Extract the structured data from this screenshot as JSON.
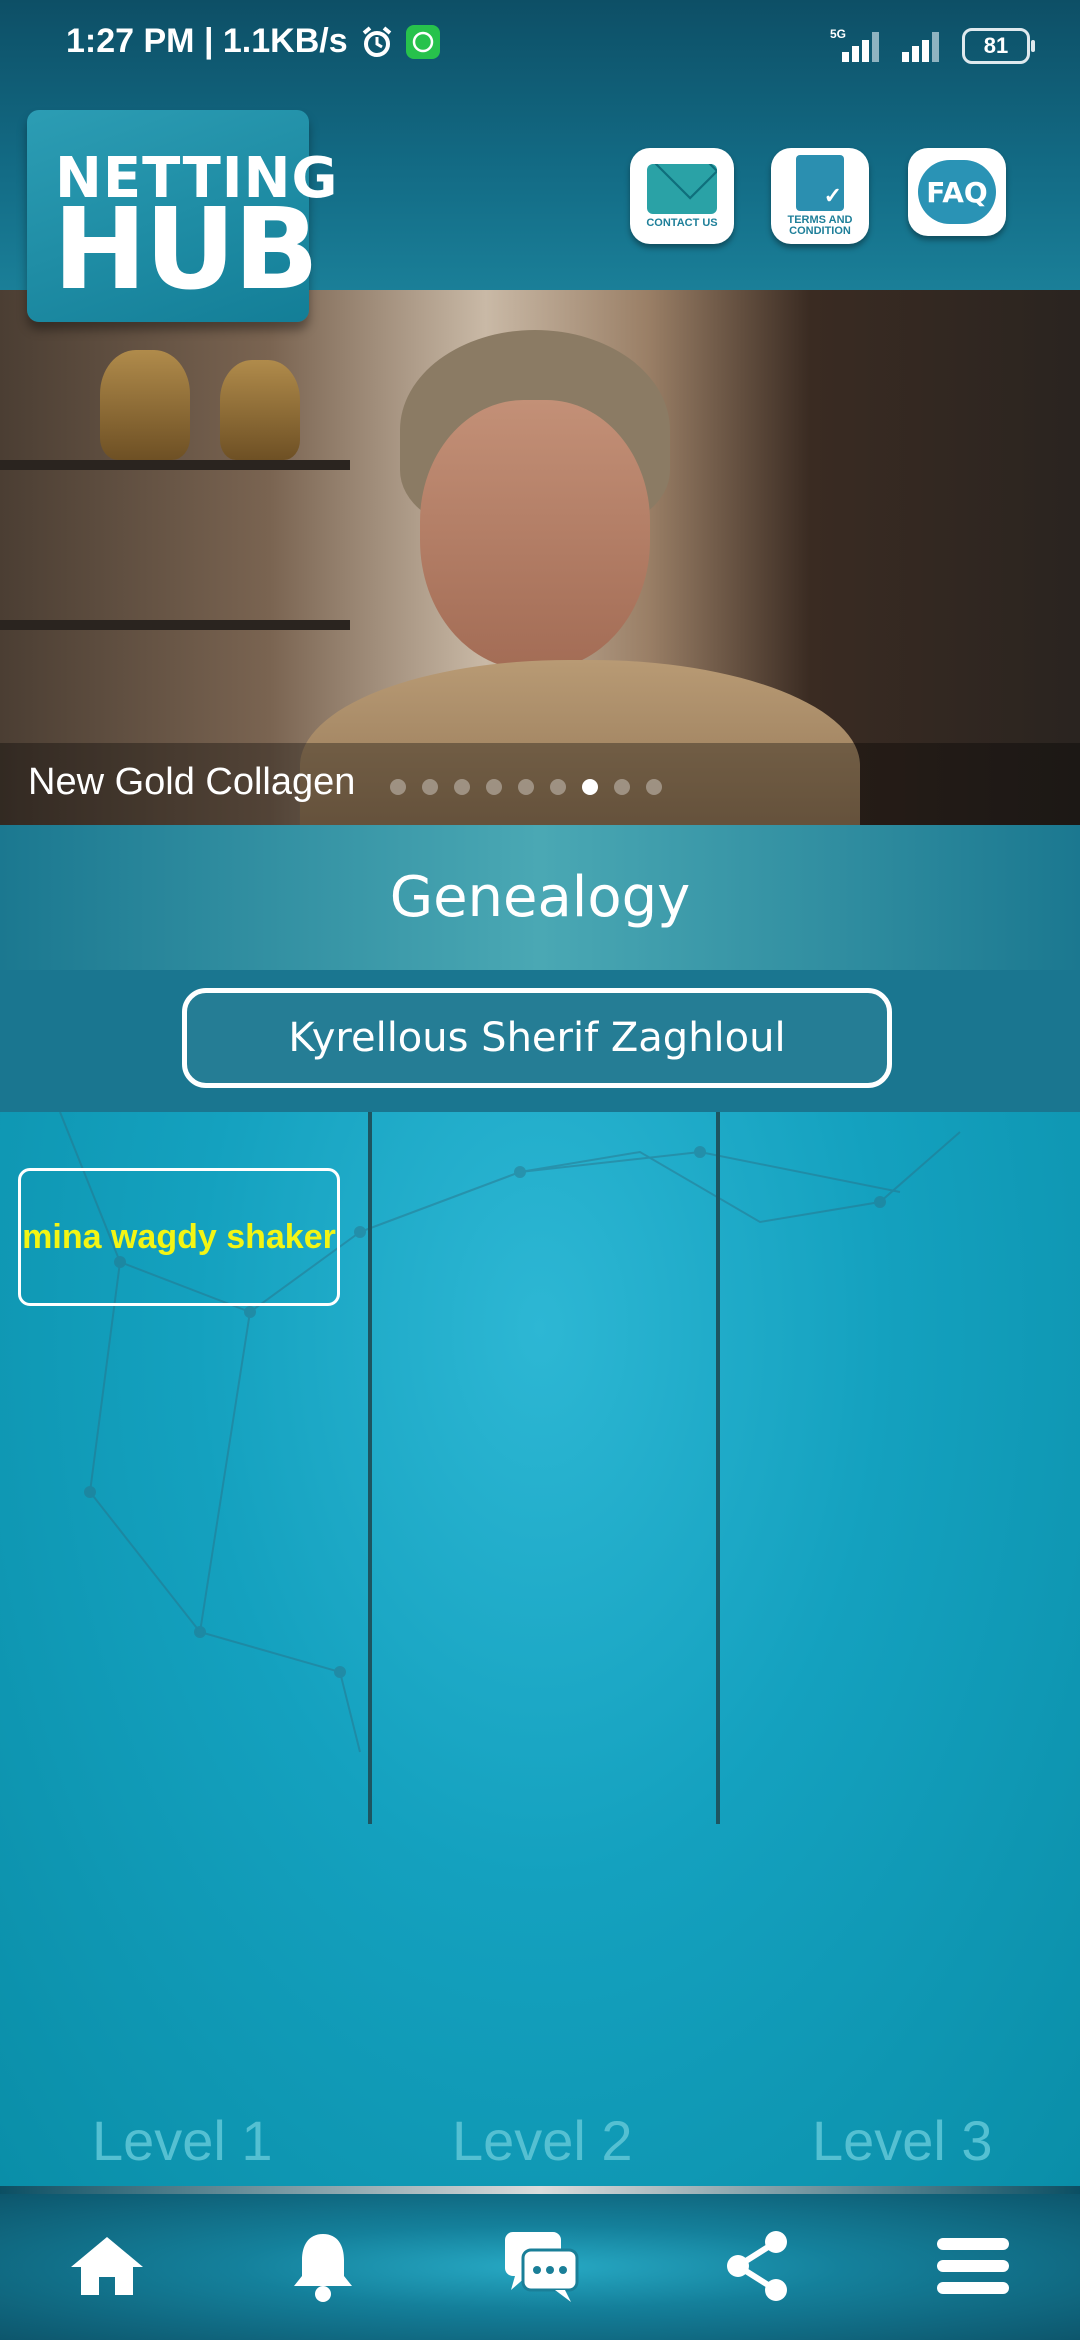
{
  "status_bar": {
    "time_speed": "1:27 PM | 1.1KB/s",
    "network": "5G",
    "battery": "81"
  },
  "logo": {
    "line1": "NETTING",
    "line2": "HUB"
  },
  "header_buttons": {
    "contact": "CONTACT US",
    "terms": "TERMS AND CONDITION",
    "faq": "FAQ"
  },
  "banner": {
    "caption": "New Gold Collagen",
    "slide_count": 9,
    "active_slide": 6
  },
  "genealogy": {
    "title": "Genealogy",
    "root_name": "Kyrellous  Sherif Zaghloul",
    "children": [
      "mina  wagdy shaker"
    ],
    "levels": [
      "Level 1",
      "Level 2",
      "Level 3"
    ]
  },
  "colors": {
    "accent": "#14a1bf",
    "child_text": "#f3f514"
  },
  "bottom_nav": [
    "home-icon",
    "bell-icon",
    "chat-icon",
    "share-icon",
    "menu-icon"
  ]
}
